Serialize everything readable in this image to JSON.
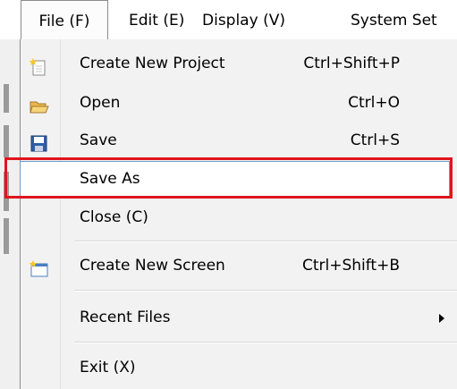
{
  "menubar": {
    "file": "File (F)",
    "edit": "Edit (E)",
    "display": "Display (V)",
    "system": "System Set"
  },
  "menu": {
    "items": [
      {
        "label": "Create New Project",
        "shortcut": "Ctrl+Shift+P",
        "icon": "new-project-icon"
      },
      {
        "label": "Open",
        "shortcut": "Ctrl+O",
        "icon": "open-folder-icon"
      },
      {
        "label": "Save",
        "shortcut": "Ctrl+S",
        "icon": "save-disk-icon"
      },
      {
        "label": "Save As",
        "shortcut": "",
        "icon": ""
      },
      {
        "label": "Close (C)",
        "shortcut": "",
        "icon": ""
      },
      {
        "label": "Create New Screen",
        "shortcut": "Ctrl+Shift+B",
        "icon": "new-screen-icon"
      },
      {
        "label": "Recent Files",
        "shortcut": "",
        "icon": "submenu-arrow-icon"
      },
      {
        "label": "Exit (X)",
        "shortcut": "",
        "icon": ""
      }
    ],
    "selected_item": "Save As"
  },
  "colors": {
    "highlight_border": "#e0141e",
    "selection_border": "#6d9bd1",
    "menu_background": "#f2f2f2"
  }
}
